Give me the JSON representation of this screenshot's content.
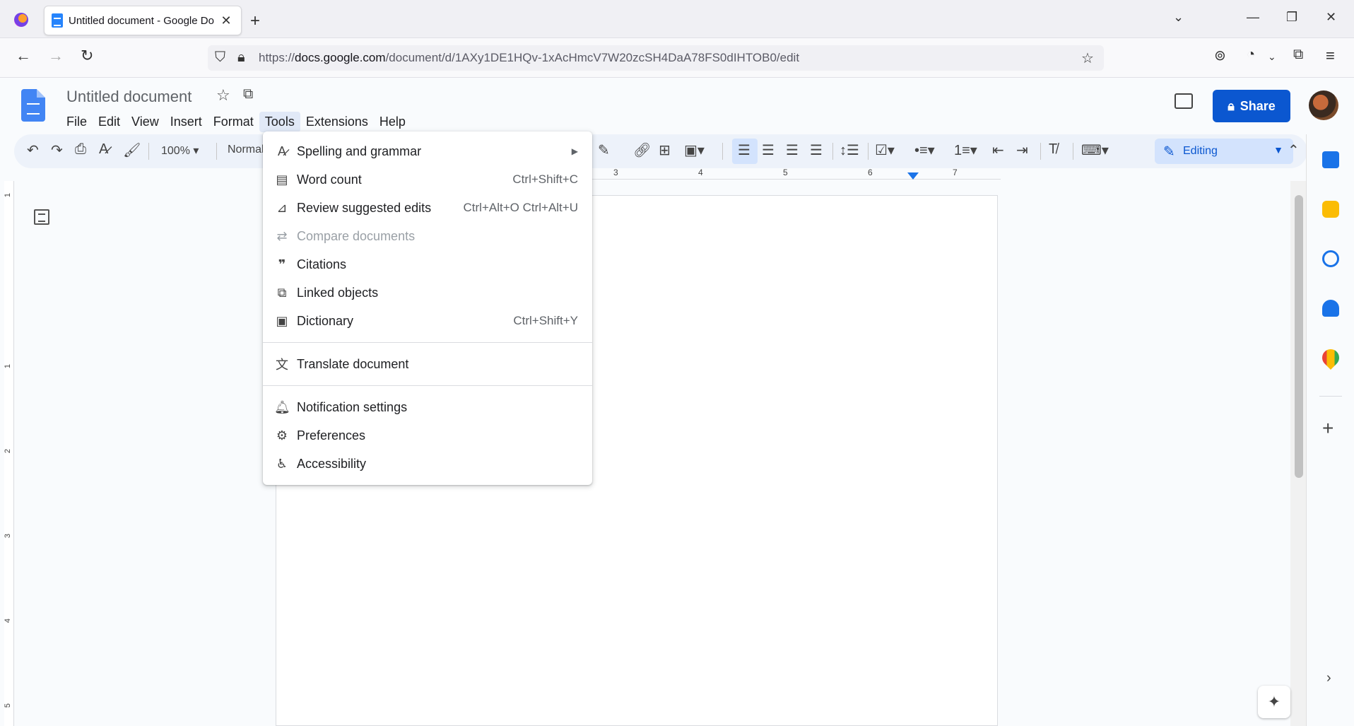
{
  "browser": {
    "tab_title": "Untitled document - Google Do",
    "url_prefix": "https://",
    "url_host": "docs.google.com",
    "url_path": "/document/d/1AXy1DE1HQv-1xAcHmcV7W20zcSH4DaA78FS0dIHTOB0/edit"
  },
  "docs": {
    "title": "Untitled document",
    "menus": [
      "File",
      "Edit",
      "View",
      "Insert",
      "Format",
      "Tools",
      "Extensions",
      "Help"
    ],
    "share_label": "Share",
    "editing_label": "Editing"
  },
  "toolbar": {
    "zoom": "100%",
    "style": "Normal"
  },
  "ruler": [
    "3",
    "4",
    "5",
    "6",
    "7"
  ],
  "vruler": [
    "1",
    "1",
    "2",
    "3",
    "4",
    "5"
  ],
  "tools_menu": {
    "items": [
      {
        "label": "Spelling and grammar",
        "shortcut": "",
        "icon": "spellcheck-icon",
        "submenu": true
      },
      {
        "label": "Word count",
        "shortcut": "Ctrl+Shift+C",
        "icon": "word-count-icon"
      },
      {
        "label": "Review suggested edits",
        "shortcut": "Ctrl+Alt+O Ctrl+Alt+U",
        "icon": "review-edits-icon"
      },
      {
        "label": "Compare documents",
        "shortcut": "",
        "icon": "compare-icon",
        "disabled": true
      },
      {
        "label": "Citations",
        "shortcut": "",
        "icon": "quote-icon"
      },
      {
        "label": "Linked objects",
        "shortcut": "",
        "icon": "link-objects-icon"
      },
      {
        "label": "Dictionary",
        "shortcut": "Ctrl+Shift+Y",
        "icon": "dictionary-icon"
      },
      {
        "label": "Translate document",
        "shortcut": "",
        "icon": "translate-icon"
      },
      {
        "label": "Notification settings",
        "shortcut": "",
        "icon": "bell-icon"
      },
      {
        "label": "Preferences",
        "shortcut": "",
        "icon": "preferences-icon"
      },
      {
        "label": "Accessibility",
        "shortcut": "",
        "icon": "accessibility-icon"
      }
    ]
  },
  "colors": {
    "accent": "#0b57d0",
    "docs_blue": "#4285f4",
    "menu_active": "#e1e9f7"
  }
}
